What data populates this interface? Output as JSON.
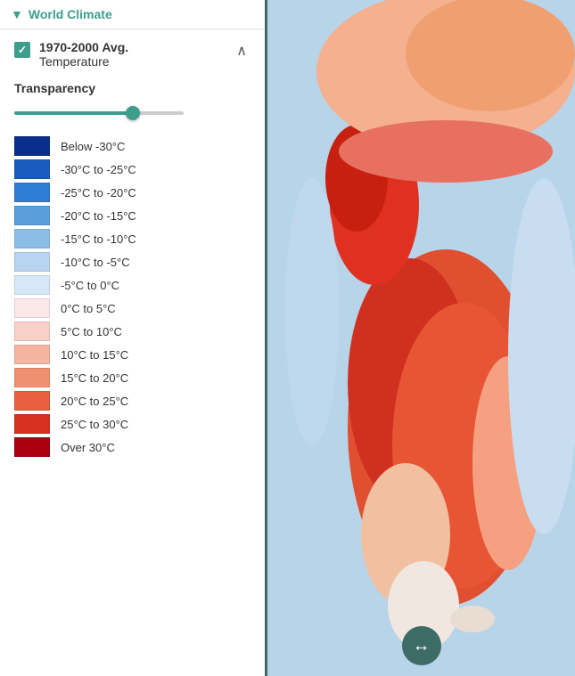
{
  "sidebar": {
    "title": "World Climate",
    "chevron": "▼",
    "layer": {
      "name_main": "1970-2000 Avg.",
      "name_sub": "Temperature",
      "checked": true
    },
    "transparency": {
      "label": "Transparency",
      "value": 72
    },
    "legend": [
      {
        "color": "#0a2e8c",
        "label": "Below -30°C"
      },
      {
        "color": "#1a5bbf",
        "label": "-30°C to -25°C"
      },
      {
        "color": "#2e7dd4",
        "label": "-25°C to -20°C"
      },
      {
        "color": "#5a9fdb",
        "label": "-20°C to -15°C"
      },
      {
        "color": "#8bbde8",
        "label": "-15°C to -10°C"
      },
      {
        "color": "#b8d4f0",
        "label": "-10°C to -5°C"
      },
      {
        "color": "#d6e8f7",
        "label": "-5°C to 0°C"
      },
      {
        "color": "#fce8e8",
        "label": "0°C to 5°C"
      },
      {
        "color": "#f9d0c8",
        "label": "5°C to 10°C"
      },
      {
        "color": "#f5b49f",
        "label": "10°C to 15°C"
      },
      {
        "color": "#f09070",
        "label": "15°C to 20°C"
      },
      {
        "color": "#e86040",
        "label": "20°C to 25°C"
      },
      {
        "color": "#d63020",
        "label": "25°C to 30°C"
      },
      {
        "color": "#aa0010",
        "label": "Over 30°C"
      }
    ]
  },
  "map": {
    "arrow_label": "↔"
  },
  "colors": {
    "accent": "#3d9e8c",
    "dark_teal": "#3d6b65"
  }
}
